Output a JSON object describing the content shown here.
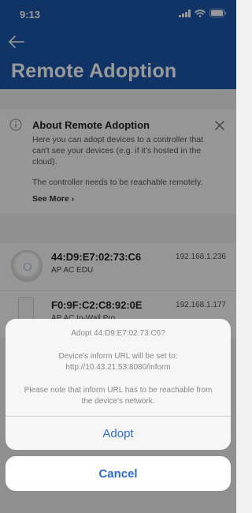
{
  "status_bar": {
    "time": "9:13"
  },
  "header": {
    "title": "Remote Adoption"
  },
  "info": {
    "title": "About Remote Adoption",
    "body_lines": [
      "Here you can adopt devices to a controller that",
      "can't see your devices (e.g. if it's hosted in the",
      "cloud)."
    ],
    "body2": "The controller needs to be reachable remotely.",
    "see_more": "See More ›"
  },
  "devices": [
    {
      "mac": "44:D9:E7:02:73:C6",
      "model": "AP AC EDU",
      "ip": "192.168.1.236"
    },
    {
      "mac": "F0:9F:C2:C8:92:0E",
      "model": "AP AC In-Wall Pro",
      "ip": "192.168.1.177"
    }
  ],
  "sheet": {
    "title": "Adopt 44:D9:E7:02:73:C6?",
    "line1": "Device's inform URL will be set to:",
    "line2": "http://10.43.21.53:8080/inform",
    "line3": "Please note that inform URL has to be reachable from",
    "line4": "the device's network.",
    "adopt_label": "Adopt",
    "cancel_label": "Cancel"
  },
  "colors": {
    "header_blue": "#1a57a8",
    "action_blue": "#2f6bd1"
  },
  "icons": [
    "back-arrow-icon",
    "info-icon",
    "close-icon",
    "wifi-icon",
    "battery-icon",
    "signal-icon"
  ]
}
